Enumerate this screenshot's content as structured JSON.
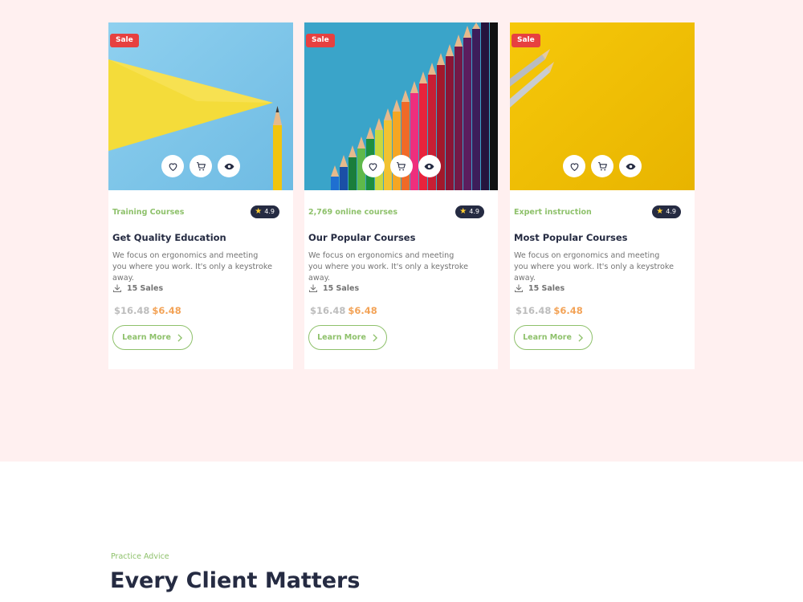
{
  "colors": {
    "page_bg": "#fff0f0",
    "accent_green": "#8ec16b",
    "sale_red": "#e74040",
    "price_orange": "#f3a357",
    "dark_navy": "#252b42",
    "muted_text": "#737373"
  },
  "cards": [
    {
      "badge": "Sale",
      "image": "yellow-triangle-pencil-on-blue",
      "actions": [
        "heart-icon",
        "cart-icon",
        "eye-icon"
      ],
      "category": "Training Courses",
      "rating": "4.9",
      "title": "Get Quality Education",
      "description": "We focus on ergonomics and meeting you where you work. It's only a keystroke away.",
      "sales": "15 Sales",
      "old_price": "$16.48",
      "new_price": "$6.48",
      "button_label": "Learn More"
    },
    {
      "badge": "Sale",
      "image": "colored-pencils-on-blue",
      "actions": [
        "heart-icon",
        "cart-icon",
        "eye-icon"
      ],
      "category": "2,769 online courses",
      "rating": "4.9",
      "title": "Our Popular Courses",
      "description": "We focus on ergonomics and meeting you where you work. It's only a keystroke away.",
      "sales": "15 Sales",
      "old_price": "$16.48",
      "new_price": "$6.48",
      "button_label": "Learn More"
    },
    {
      "badge": "Sale",
      "image": "grey-pencils-on-yellow",
      "actions": [
        "heart-icon",
        "cart-icon",
        "eye-icon"
      ],
      "category": "Expert instruction",
      "rating": "4.9",
      "title": "Most Popular Courses",
      "description": "We focus on ergonomics and meeting you where you work. It's only a keystroke away.",
      "sales": "15 Sales",
      "old_price": "$16.48",
      "new_price": "$6.48",
      "button_label": "Learn More"
    }
  ],
  "section": {
    "kicker": "Practice Advice",
    "heading": "Every Client Matters"
  }
}
